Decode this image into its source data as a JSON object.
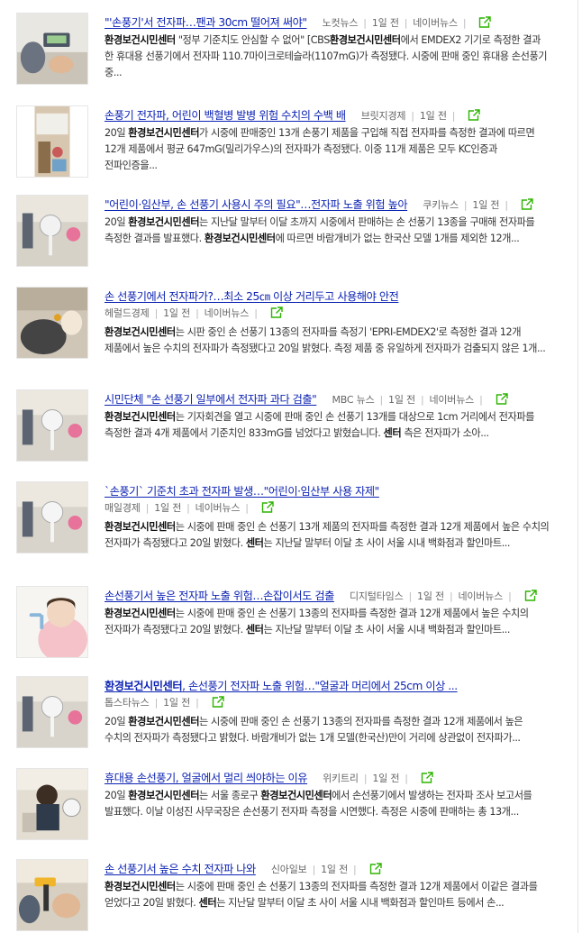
{
  "colors": {
    "headline": "#0d23b3",
    "share_icon": "#2db400",
    "separator": "#bbbbbb"
  },
  "share_icon": "share-out-icon",
  "items": [
    {
      "title": "\"'손풍기'서 전자파…팬과 30cm 떨어져 써야\"",
      "meta": [
        "노컷뉴스",
        "1일 전",
        "네이버뉴스"
      ],
      "snippet_parts": [
        {
          "b": "환경보건시민센터"
        },
        {
          "t": " \"정부 기준치도 안심할 수 없어\" [CBS"
        },
        {
          "b": "환경보건시민센터"
        },
        {
          "t": "에서 EMDEX2 기기로 측정한 결과 한 휴대용 선풍기에서 전자파 110.7마이크로테슬라(1107mG)가 측정됐다. 시중에 판매 중인 휴대용 손선풍기 중..."
        }
      ]
    },
    {
      "title": "손풍기 전자파, 어린이 백혈병 발병 위험 수치의 수백 배",
      "meta": [
        "브릿지경제",
        "1일 전"
      ],
      "snippet_parts": [
        {
          "t": "20일 "
        },
        {
          "b": "환경보건시민센터"
        },
        {
          "t": "가 시중에 판매중인 13개 손풍기 제품을 구입해 직접 전자파를 측정한 결과에 따르면 12개 제품에서 평균 647mG(밀리가우스)의 전자파가 측정됐다. 이중 11개 제품은 모두 KC인증과 전파인증을..."
        }
      ]
    },
    {
      "title": "\"어린이·임산부, 손 선풍기 사용시 주의 필요\"…전자파 노출 위험 높아",
      "meta": [
        "쿠키뉴스",
        "1일 전"
      ],
      "snippet_parts": [
        {
          "t": "20일 "
        },
        {
          "b": "환경보건시민센터"
        },
        {
          "t": "는 지난달 말부터 이달 초까지 시중에서 판매하는 손 선풍기 13종을 구매해 전자파를 측정한 결과를 발표했다. "
        },
        {
          "b": "환경보건시민센터"
        },
        {
          "t": "에 따르면 바람개비가 없는 한국산 모델 1개를 제외한 12개..."
        }
      ]
    },
    {
      "title": "손 선풍기에서 전자파가?…최소 25㎝ 이상 거리두고 사용해야 안전",
      "meta": [
        "헤럴드경제",
        "1일 전",
        "네이버뉴스"
      ],
      "snippet_parts": [
        {
          "b": "환경보건시민센터"
        },
        {
          "t": "는 시판 중인 손 선풍기 13종의 전자파를 측정기 'EPRI-EMDEX2'로 측정한 결과 12개 제품에서 높은 수치의 전자파가 측정됐다고 20일 밝혔다. 측정 제품 중 유일하게 전자파가 검출되지 않은 1개..."
        }
      ]
    },
    {
      "title": "시민단체 \"손 선풍기 일부에서 전자파 과다 검출\"",
      "meta": [
        "MBC 뉴스",
        "1일 전",
        "네이버뉴스"
      ],
      "snippet_parts": [
        {
          "b": "환경보건시민센터"
        },
        {
          "t": "는 기자회견을 열고 시중에 판매 중인 손 선풍기 13개를 대상으로 1cm 거리에서 전자파를 측정한 결과 4개 제품에서 기준치인 833mG를 넘었다고 밝혔습니다. "
        },
        {
          "b": "센터"
        },
        {
          "t": " 측은 전자파가 소아..."
        }
      ]
    },
    {
      "title": "`손풍기` 기준치 초과 전자파 발생…\"어린이·임산부 사용 자제\"",
      "meta": [
        "매일경제",
        "1일 전",
        "네이버뉴스"
      ],
      "snippet_parts": [
        {
          "b": "환경보건시민센터"
        },
        {
          "t": "는 시중에 판매 중인 손 선풍기 13개 제품의 전자파를 측정한 결과 12개 제품에서 높은 수치의 전자파가 측정됐다고 20일 밝혔다. "
        },
        {
          "b": "센터"
        },
        {
          "t": "는 지난달 말부터 이달 초 사이 서울 시내 백화점과 할인마트..."
        }
      ]
    },
    {
      "title": "손선풍기서 높은 전자파 노출 위험…손잡이서도 검출",
      "meta": [
        "디지털타임스",
        "1일 전",
        "네이버뉴스"
      ],
      "snippet_parts": [
        {
          "b": "환경보건시민센터"
        },
        {
          "t": "는 시중에 판매 중인 손 선풍기 13종의 전자파를 측정한 결과 12개 제품에서 높은 수치의 전자파가 측정됐다고 20일 밝혔다. "
        },
        {
          "b": "센터"
        },
        {
          "t": "는 지난달 말부터 이달 초 사이 서울 시내 백화점과 할인마트..."
        }
      ]
    },
    {
      "title_parts": [
        {
          "b": "환경보건시민센터"
        },
        {
          "t": ", 손선풍기 전자파 노출 위험…\"얼굴과 머리에서 25cm 이상 ..."
        }
      ],
      "meta": [
        "톱스타뉴스",
        "1일 전"
      ],
      "snippet_parts": [
        {
          "t": "20일 "
        },
        {
          "b": "환경보건시민센터"
        },
        {
          "t": "는 시중에 판매 중인 손 선풍기 13종의 전자파를 측정한 결과 12개 제품에서 높은 수치의 전자파가 측정됐다고 밝혔다. 바람개비가 없는 1개 모델(한국산)만이 거리에 상관없이 전자파가..."
        }
      ]
    },
    {
      "title": "휴대용 손선풍기, 얼굴에서 멀리 씌야하는 이유",
      "meta": [
        "위키트리",
        "1일 전"
      ],
      "snippet_parts": [
        {
          "t": "20일 "
        },
        {
          "b": "환경보건시민센터"
        },
        {
          "t": "는 서울 종로구 "
        },
        {
          "b": "환경보건시민센터"
        },
        {
          "t": "에서 손선풍기에서 발생하는 전자파 조사 보고서를 발표했다. 이날 이성진 사무국장은 손선풍기 전자파 측정을 시연했다. 측정은 시중에 판매하는 총 13개..."
        }
      ]
    },
    {
      "title": "손 선풍기서 높은 수치 전자파 나와",
      "meta": [
        "신아일보",
        "1일 전"
      ],
      "snippet_parts": [
        {
          "b": "환경보건시민센터"
        },
        {
          "t": "는 시중에 판매 중인 손 선풍기 13종의 전자파를 측정한 결과 12개 제품에서 이같은 결과를 얻었다고 20일 밝혔다. "
        },
        {
          "b": "센터"
        },
        {
          "t": "는 지난달 말부터 이달 초 사이 서울 시내 백화점과 할인마트 등에서 손..."
        }
      ]
    }
  ]
}
